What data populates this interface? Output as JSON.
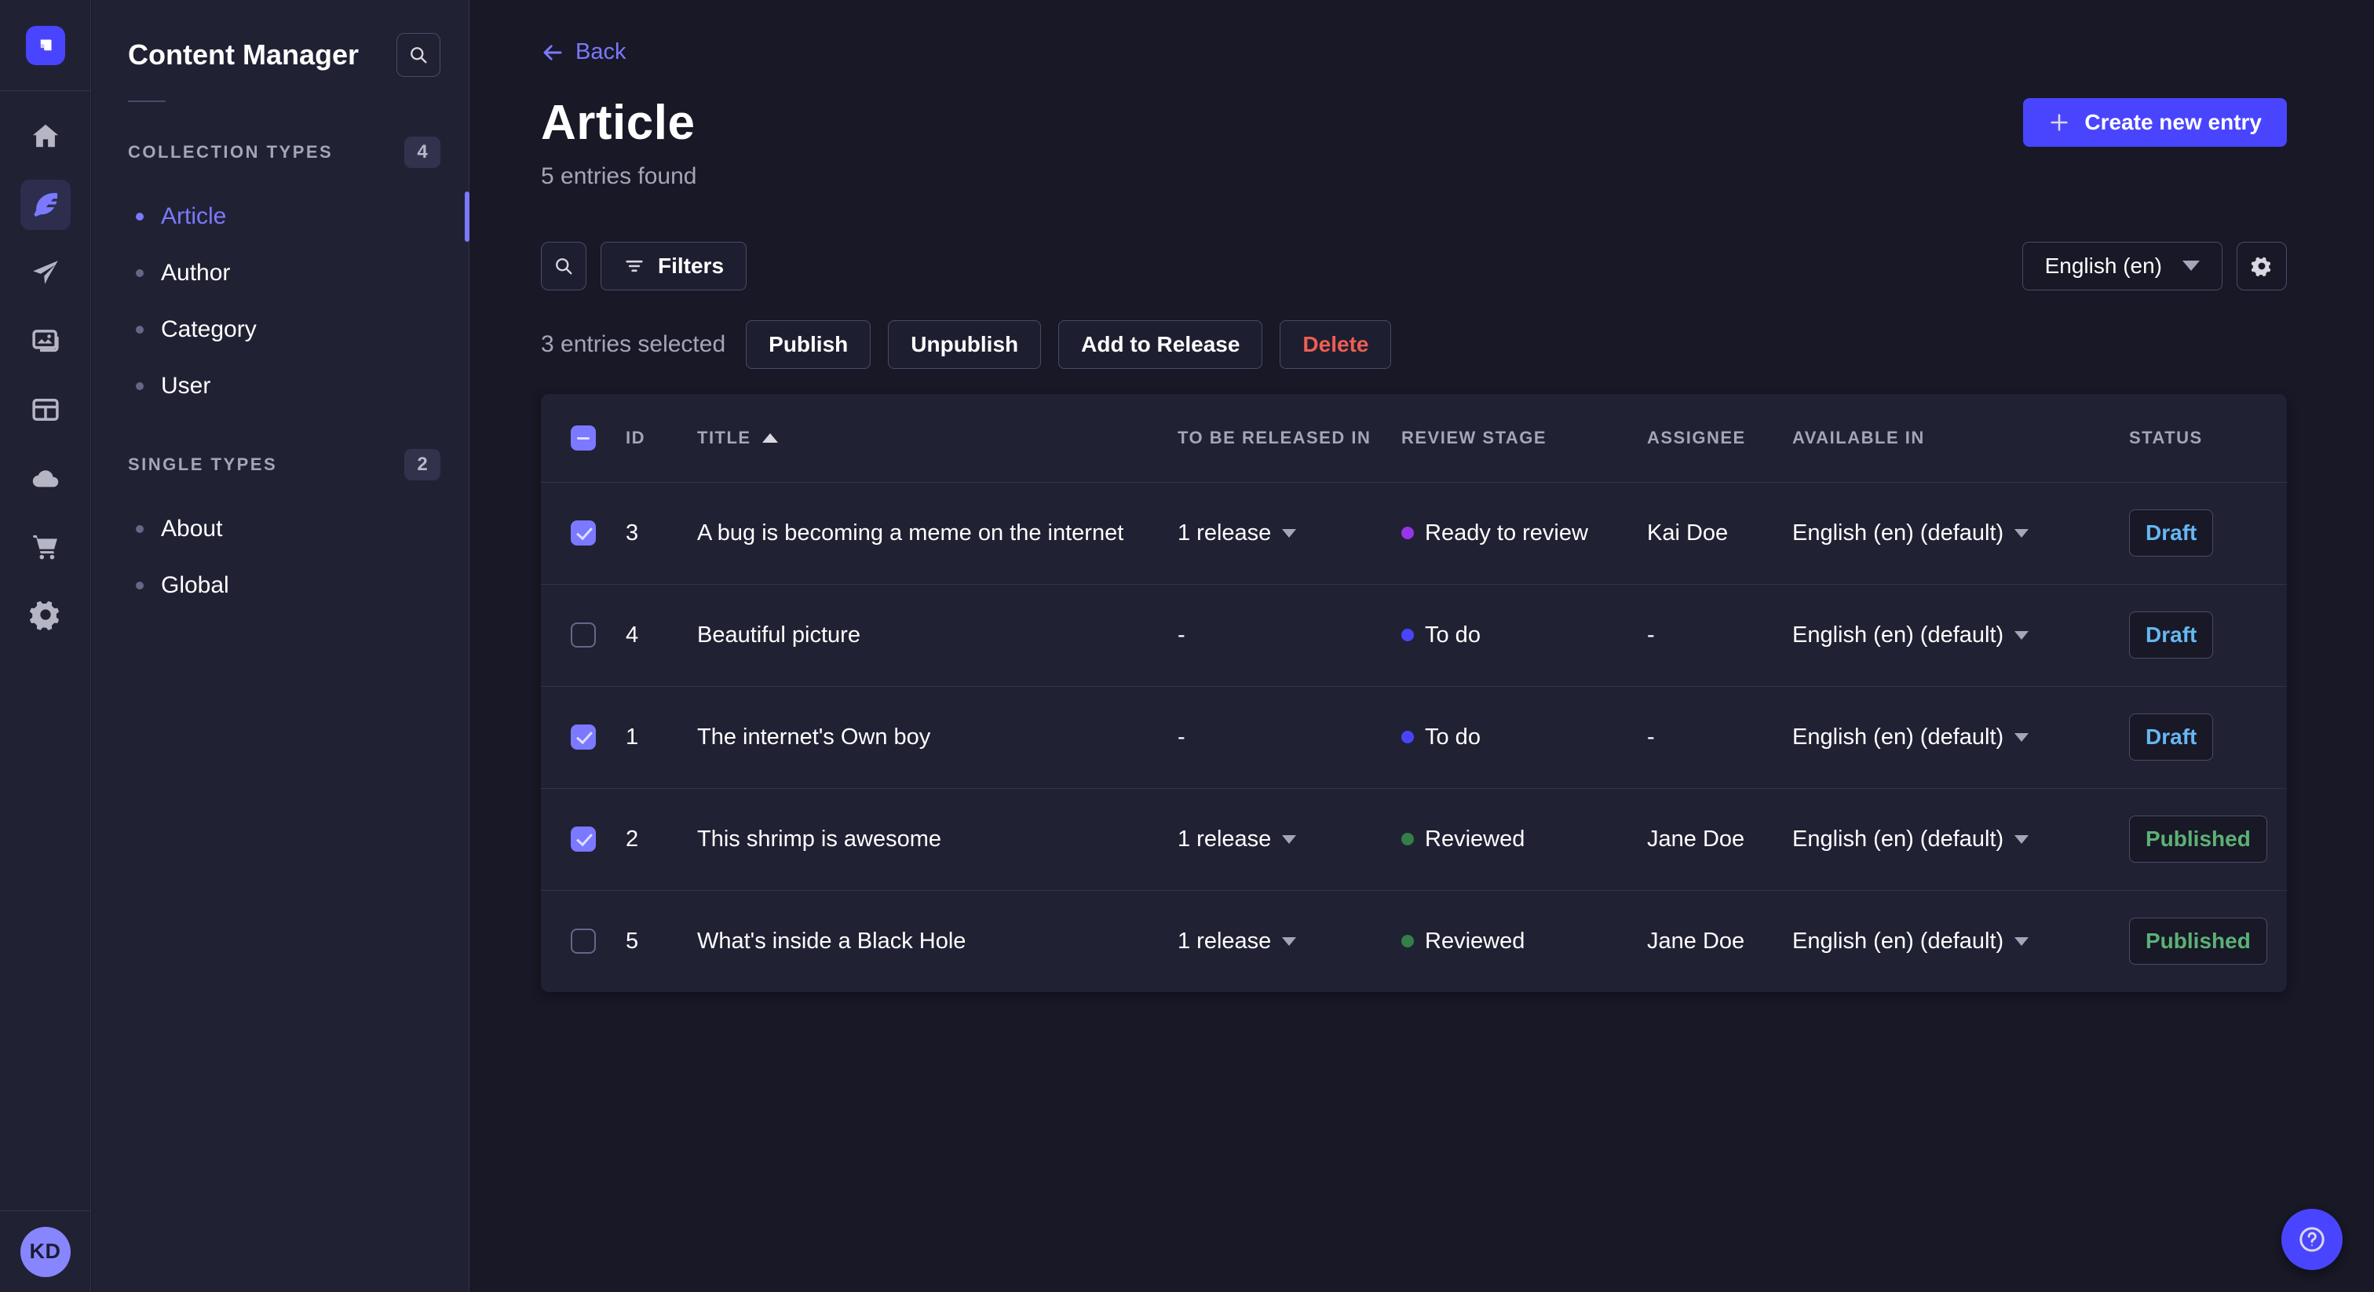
{
  "colors": {
    "accent": "#4945ff",
    "accent_light": "#7b79ff",
    "page_bg": "#181826",
    "panel_bg": "#212134",
    "border": "#32324d",
    "draft": "#66b7f1",
    "published": "#5cb176",
    "danger": "#ee5e52"
  },
  "rail": {
    "icons": [
      "home-icon",
      "content-manager-feather-icon",
      "releases-paper-plane-icon",
      "media-library-images-icon",
      "content-type-builder-layout-icon",
      "cloud-icon",
      "marketplace-cart-icon",
      "settings-gear-icon"
    ],
    "active_icon": "content-manager-feather-icon",
    "avatar_initials": "KD"
  },
  "sidebar": {
    "title": "Content Manager",
    "sections": [
      {
        "label": "COLLECTION TYPES",
        "count": "4",
        "items": [
          {
            "label": "Article",
            "active": true
          },
          {
            "label": "Author",
            "active": false
          },
          {
            "label": "Category",
            "active": false
          },
          {
            "label": "User",
            "active": false
          }
        ]
      },
      {
        "label": "SINGLE TYPES",
        "count": "2",
        "items": [
          {
            "label": "About",
            "active": false
          },
          {
            "label": "Global",
            "active": false
          }
        ]
      }
    ]
  },
  "header": {
    "back_label": "Back",
    "title": "Article",
    "subtitle": "5 entries found",
    "create_label": "Create new entry"
  },
  "toolbar": {
    "filters_label": "Filters",
    "locale_value": "English (en)"
  },
  "selection": {
    "summary": "3 entries selected",
    "publish_label": "Publish",
    "unpublish_label": "Unpublish",
    "add_to_release_label": "Add to Release",
    "delete_label": "Delete"
  },
  "table": {
    "select_all_state": "indeterminate",
    "sort_column": "TITLE",
    "sort_direction": "asc",
    "headers": {
      "id": "ID",
      "title": "TITLE",
      "released": "TO BE RELEASED IN",
      "review": "REVIEW STAGE",
      "assignee": "ASSIGNEE",
      "available": "AVAILABLE IN",
      "status": "STATUS"
    },
    "stage_colors": {
      "Ready to review": "#9736e8",
      "To do": "#4945ff",
      "Reviewed": "#328048"
    },
    "status_colors": {
      "Draft": "#66b7f1",
      "Published": "#5cb176"
    },
    "rows": [
      {
        "checked": true,
        "id": "3",
        "title": "A bug is becoming a meme on the internet",
        "released": "1 release",
        "released_dropdown": true,
        "stage": "Ready to review",
        "assignee": "Kai Doe",
        "available": "English (en) (default)",
        "status": "Draft"
      },
      {
        "checked": false,
        "id": "4",
        "title": "Beautiful picture",
        "released": "-",
        "released_dropdown": false,
        "stage": "To do",
        "assignee": "-",
        "available": "English (en) (default)",
        "status": "Draft"
      },
      {
        "checked": true,
        "id": "1",
        "title": "The internet's Own boy",
        "released": "-",
        "released_dropdown": false,
        "stage": "To do",
        "assignee": "-",
        "available": "English (en) (default)",
        "status": "Draft"
      },
      {
        "checked": true,
        "id": "2",
        "title": "This shrimp is awesome",
        "released": "1 release",
        "released_dropdown": true,
        "stage": "Reviewed",
        "assignee": "Jane Doe",
        "available": "English (en) (default)",
        "status": "Published"
      },
      {
        "checked": false,
        "id": "5",
        "title": "What's inside a Black Hole",
        "released": "1 release",
        "released_dropdown": true,
        "stage": "Reviewed",
        "assignee": "Jane Doe",
        "available": "English (en) (default)",
        "status": "Published"
      }
    ]
  }
}
